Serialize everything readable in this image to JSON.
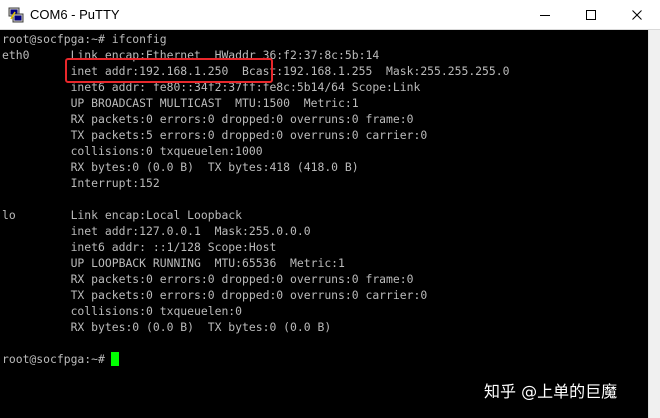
{
  "window": {
    "title": "COM6 - PuTTY",
    "icon": "putty-icon",
    "controls": [
      "minimize-icon",
      "maximize-icon",
      "close-icon"
    ]
  },
  "terminal": {
    "lines": [
      "root@socfpga:~# ifconfig",
      "eth0      Link encap:Ethernet  HWaddr 36:f2:37:8c:5b:14",
      "          inet addr:192.168.1.250  Bcast:192.168.1.255  Mask:255.255.255.0",
      "          inet6 addr: fe80::34f2:37ff:fe8c:5b14/64 Scope:Link",
      "          UP BROADCAST MULTICAST  MTU:1500  Metric:1",
      "          RX packets:0 errors:0 dropped:0 overruns:0 frame:0",
      "          TX packets:5 errors:0 dropped:0 overruns:0 carrier:0",
      "          collisions:0 txqueuelen:1000",
      "          RX bytes:0 (0.0 B)  TX bytes:418 (418.0 B)",
      "          Interrupt:152",
      "",
      "lo        Link encap:Local Loopback",
      "          inet addr:127.0.0.1  Mask:255.0.0.0",
      "          inet6 addr: ::1/128 Scope:Host",
      "          UP LOOPBACK RUNNING  MTU:65536  Metric:1",
      "          RX packets:0 errors:0 dropped:0 overruns:0 frame:0",
      "          TX packets:0 errors:0 dropped:0 overruns:0 carrier:0",
      "          collisions:0 txqueuelen:0",
      "          RX bytes:0 (0.0 B)  TX bytes:0 (0.0 B)",
      "",
      "root@socfpga:~#"
    ],
    "text_color": "#bbbbbb",
    "background": "#000000",
    "cursor_color": "#00ff00",
    "highlight_color": "#e8272b"
  },
  "watermark": {
    "text": "知乎 @上单的巨魔"
  }
}
